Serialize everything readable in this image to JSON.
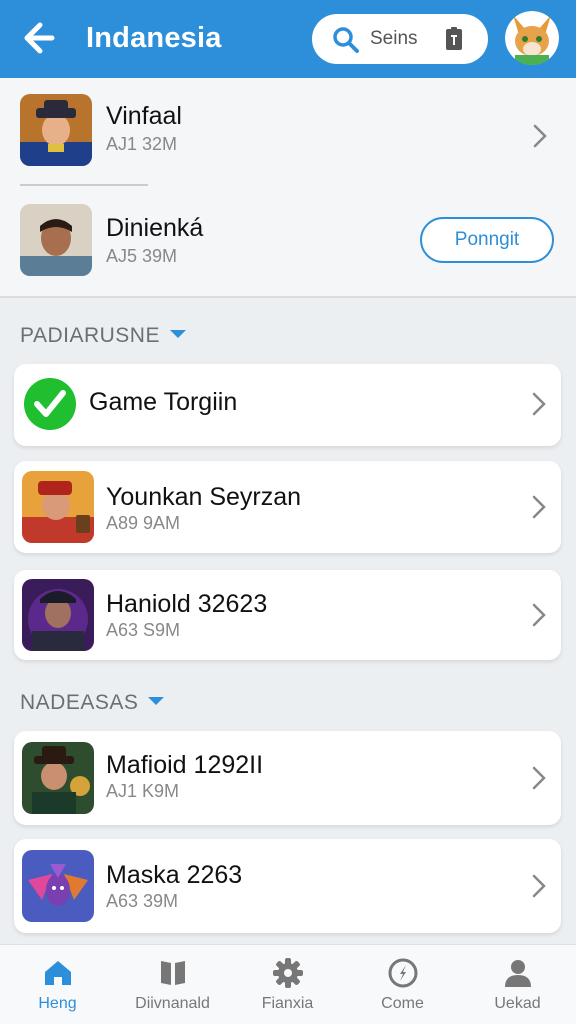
{
  "header": {
    "title": "Indanesia",
    "search_text": "Seins"
  },
  "top_items": [
    {
      "name": "Vinfaal",
      "sub": "AJ1 32M"
    },
    {
      "name": "Dinienká",
      "sub": "AJ5 39M",
      "action": "Ponngit"
    }
  ],
  "sections": [
    {
      "title": "PADIARUSNE",
      "items": [
        {
          "name": "Game Torgiin",
          "sub": ""
        },
        {
          "name": "Younkan Seyrzan",
          "sub": "A89 9AM"
        },
        {
          "name": "Haniold 32623",
          "sub": "A63 S9M"
        }
      ]
    },
    {
      "title": "NADEASAS",
      "items": [
        {
          "name": "Mafioid 1292ΙΙ",
          "sub": "AJ1 K9M"
        },
        {
          "name": "Maska 2263",
          "sub": "A63 39M"
        }
      ]
    }
  ],
  "nav": [
    {
      "label": "Heng",
      "icon": "home-icon",
      "active": true
    },
    {
      "label": "Diivnanald",
      "icon": "book-icon",
      "active": false
    },
    {
      "label": "Fianxia",
      "icon": "gear-icon",
      "active": false
    },
    {
      "label": "Come",
      "icon": "compass-icon",
      "active": false
    },
    {
      "label": "Uekad",
      "icon": "person-icon",
      "active": false
    }
  ],
  "colors": {
    "accent": "#2d8fd9",
    "check_green": "#1fbf2f",
    "background": "#eceff2"
  }
}
